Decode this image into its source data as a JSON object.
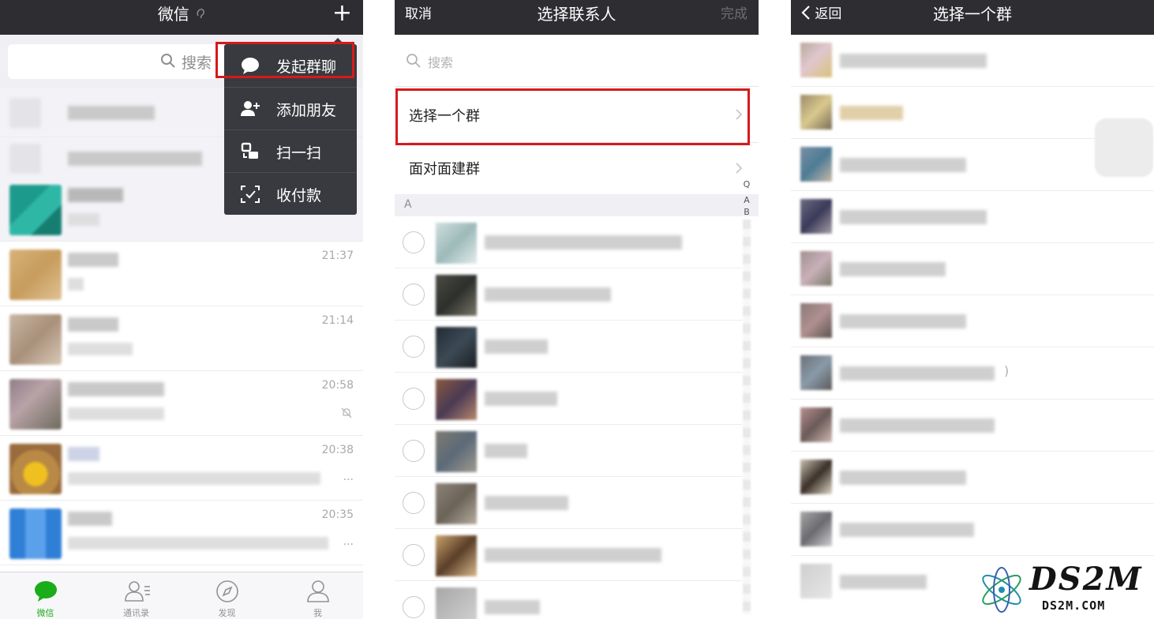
{
  "panel1": {
    "title": "微信",
    "plus": "+",
    "search_placeholder": "搜索",
    "menu": [
      {
        "label": "发起群聊",
        "icon": "chat-bubble-icon"
      },
      {
        "label": "添加朋友",
        "icon": "add-friend-icon"
      },
      {
        "label": "扫一扫",
        "icon": "scan-icon"
      },
      {
        "label": "收付款",
        "icon": "payment-icon"
      }
    ],
    "chats": [
      {
        "time": ""
      },
      {
        "time": ""
      },
      {
        "time": ""
      },
      {
        "time": "21:37"
      },
      {
        "time": "21:14"
      },
      {
        "time": "20:58",
        "muted": true
      },
      {
        "time": "20:38",
        "suffix": "..."
      },
      {
        "time": "20:35",
        "suffix": "..."
      }
    ],
    "tabs": [
      {
        "label": "微信",
        "icon": "chats-icon",
        "active": true
      },
      {
        "label": "通讯录",
        "icon": "contacts-icon"
      },
      {
        "label": "发现",
        "icon": "discover-icon"
      },
      {
        "label": "我",
        "icon": "me-icon"
      }
    ]
  },
  "panel2": {
    "cancel": "取消",
    "title": "选择联系人",
    "done": "完成",
    "search_placeholder": "搜索",
    "select_group": "选择一个群",
    "face_to_face": "面对面建群",
    "section_letter": "A",
    "index_letters": [
      "Q",
      "A",
      "B"
    ]
  },
  "panel3": {
    "back": "返回",
    "title": "选择一个群",
    "partial_text": ")"
  },
  "watermark": {
    "main": "DS2M",
    "sub": "DS2M.COM"
  },
  "colors": {
    "navbar": "#2e2e32",
    "highlight": "#d7191b",
    "wechat_green": "#1aad19",
    "menu_bg": "#393a3f"
  }
}
